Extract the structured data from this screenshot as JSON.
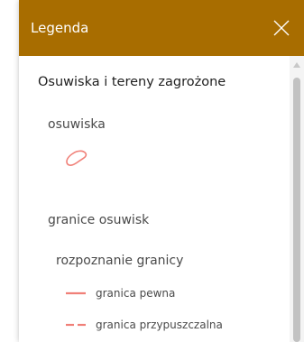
{
  "colors": {
    "header_bg": "#a86d00",
    "header_text": "#ffffff",
    "symbol_red": "#f08078"
  },
  "header": {
    "title": "Legenda",
    "close_icon": "close-icon"
  },
  "legend": {
    "layer_title": "Osuwiska i tereny zagrożone",
    "groups": [
      {
        "label": "osuwiska",
        "symbol": "landslide-polygon-icon"
      },
      {
        "label": "granice osuwisk",
        "subgroup_label": "rozpoznanie granicy",
        "items": [
          {
            "label": "granica pewna",
            "line_style": "solid"
          },
          {
            "label": "granica przypuszczalna",
            "line_style": "dashed"
          }
        ]
      }
    ]
  },
  "scrollbar": {
    "up_icon": "scroll-up-arrow-icon"
  }
}
